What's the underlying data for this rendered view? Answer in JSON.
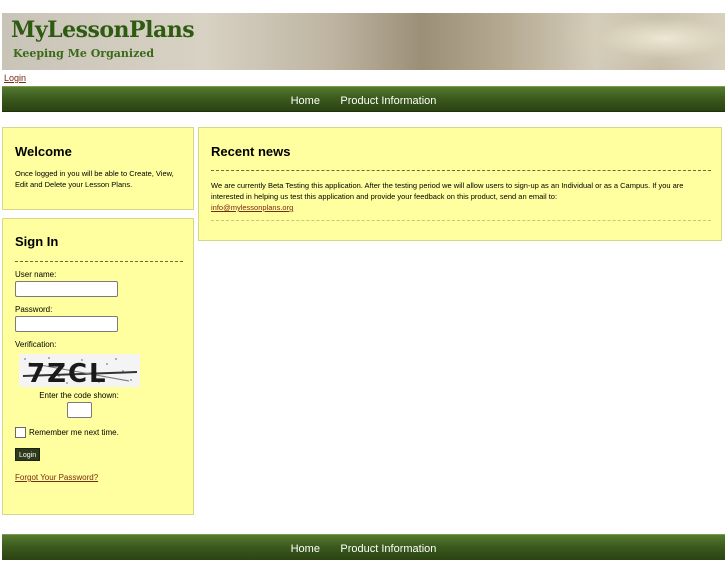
{
  "header": {
    "title": "MyLessonPlans",
    "tagline": "Keeping Me Organized",
    "login_link": "Login"
  },
  "nav": {
    "items": [
      "Home",
      "Product Information"
    ]
  },
  "welcome": {
    "title": "Welcome",
    "text": "Once logged in you will be able to Create, View, Edit and Delete your Lesson Plans."
  },
  "signin": {
    "title": "Sign In",
    "username_label": "User name:",
    "password_label": "Password:",
    "verification_label": "Verification:",
    "captcha_text": "7ZCL",
    "code_hint": "Enter the code shown:",
    "remember_label": "Remember me next time.",
    "login_button": "Login",
    "forgot_link": "Forgot Your Password?"
  },
  "news": {
    "title": "Recent news",
    "text": "We are currently Beta Testing this application. After the testing period we will allow users to sign-up as an Individual or as a Campus. If you are interested in helping us test this application and provide your feedback on this product, send an email to:",
    "email": "info@mylessonplans.org"
  },
  "footer": {
    "items": [
      "Home",
      "Product Information"
    ]
  },
  "colors": {
    "nav_green": "#3c5b1e",
    "panel_yellow": "#ffff9f",
    "title_green": "#2f5a12",
    "link_brown": "#7a2a10"
  }
}
